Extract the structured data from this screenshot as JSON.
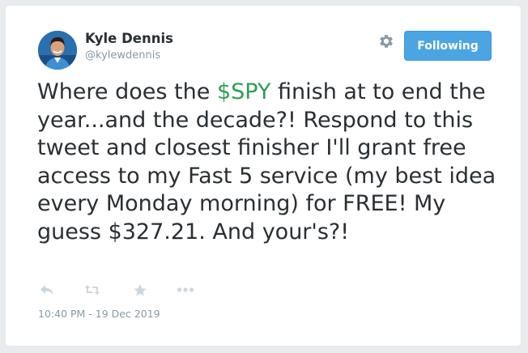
{
  "tweet": {
    "author": {
      "name": "Kyle Dennis",
      "handle": "@kylewdennis"
    },
    "follow_button_label": "Following",
    "text_before": "Where does the ",
    "cashtag": "$SPY",
    "text_after": " finish at to end the year...and the decade?! Respond to this tweet and closest finisher I'll grant free access to my Fast 5 service (my best idea every Monday morning) for FREE! My guess $327.21. And your's?!",
    "timestamp": "10:40 PM - 19 Dec 2019",
    "actions": [
      "reply-icon",
      "retweet-icon",
      "like-icon",
      "more-icon"
    ]
  },
  "colors": {
    "text": "#292f33",
    "muted": "#8899a6",
    "cashtag": "#2e9e53",
    "follow_button": "#4ca5e3",
    "icons": "#ccd6dd",
    "gear": "#8899a6"
  }
}
